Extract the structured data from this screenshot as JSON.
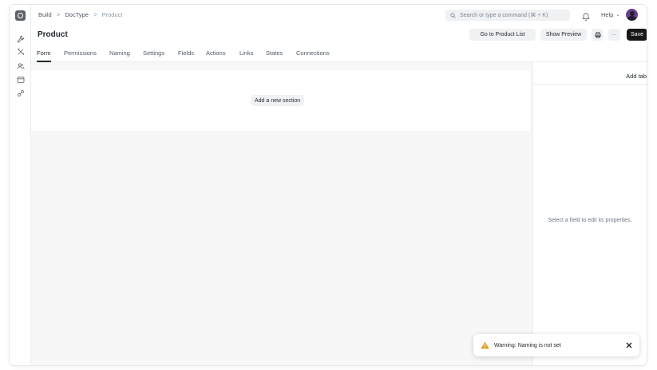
{
  "breadcrumb": {
    "items": [
      "Build",
      "DocType",
      "Product"
    ],
    "separator": ">"
  },
  "search": {
    "placeholder": "Search or type a command (⌘ + K)"
  },
  "header": {
    "help_label": "Help"
  },
  "page": {
    "title": "Product"
  },
  "actions": {
    "go_to_list": "Go to Product List",
    "show_preview": "Show Preview",
    "more": "···",
    "save": "Save"
  },
  "tabs": [
    {
      "label": "Form",
      "active": true
    },
    {
      "label": "Permissions"
    },
    {
      "label": "Naming"
    },
    {
      "label": "Settings"
    },
    {
      "label": "Fields"
    },
    {
      "label": "Actions"
    },
    {
      "label": "Links"
    },
    {
      "label": "States"
    },
    {
      "label": "Connections"
    }
  ],
  "form": {
    "add_section_label": "Add a new section"
  },
  "properties": {
    "add_tab_label": "Add tab",
    "empty_text": "Select a field to edit its properties."
  },
  "toast": {
    "message": "Warning: Naming is not set",
    "icon": "warning-icon",
    "color": "#e79913"
  },
  "sidebar": {
    "icons": [
      "wrench-icon",
      "tools-icon",
      "users-icon",
      "window-icon",
      "integration-icon"
    ]
  }
}
